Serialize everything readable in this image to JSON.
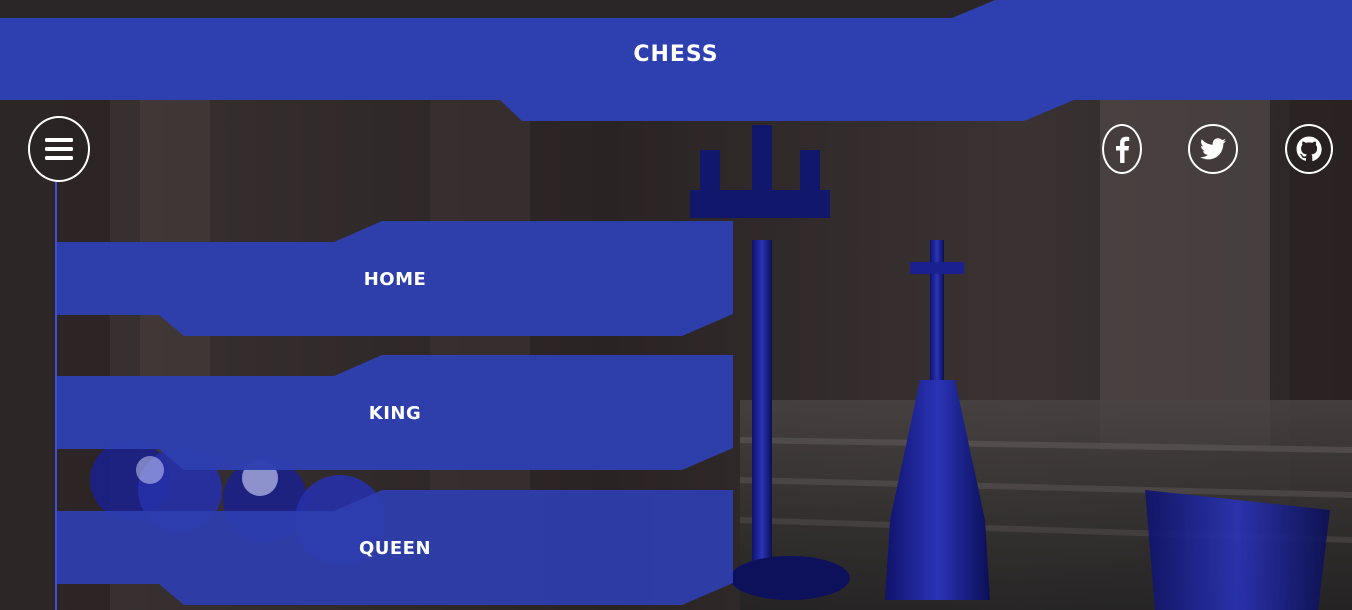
{
  "header": {
    "title": "CHESS"
  },
  "toolbar": {
    "menu_icon": "hamburger-icon",
    "social": [
      {
        "name": "facebook",
        "icon": "facebook-icon"
      },
      {
        "name": "twitter",
        "icon": "twitter-icon"
      },
      {
        "name": "github",
        "icon": "github-icon"
      }
    ]
  },
  "menu": {
    "items": [
      {
        "label": "HOME"
      },
      {
        "label": "KING"
      },
      {
        "label": "QUEEN"
      }
    ]
  },
  "colors": {
    "accent": "#2e3fb0",
    "header_dark": "#2a2628",
    "text": "#ffffff",
    "rail": "#3f50d6"
  }
}
